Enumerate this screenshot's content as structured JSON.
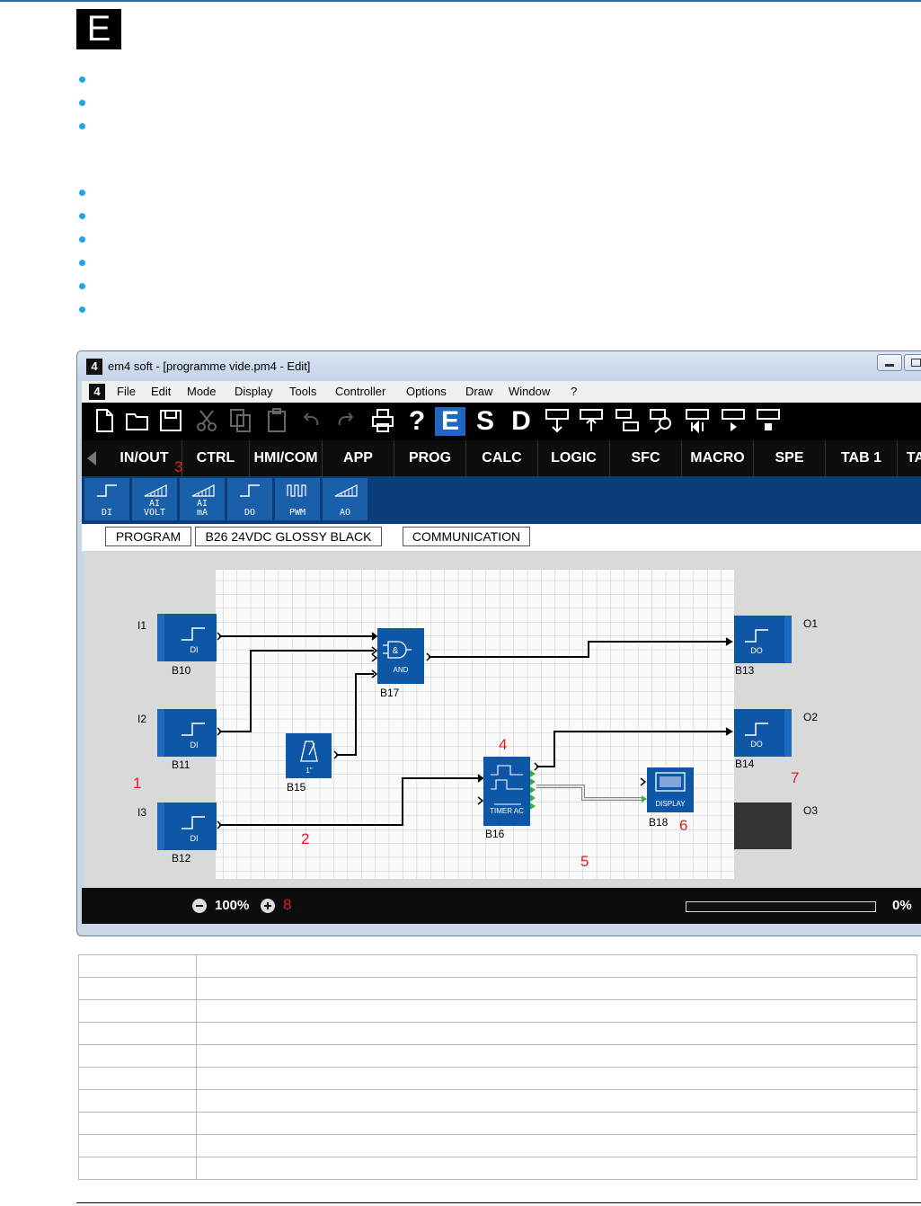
{
  "badge": "E",
  "window": {
    "title": "em4 soft - [programme vide.pm4 - Edit]",
    "app_icon": "4"
  },
  "menu": [
    "File",
    "Edit",
    "Mode",
    "Display",
    "Tools",
    "Controller",
    "Options",
    "Draw",
    "Window",
    "?"
  ],
  "toolbar": {
    "icons": [
      "new-file-icon",
      "open-folder-icon",
      "save-icon",
      "cut-icon",
      "copy-icon",
      "paste-icon",
      "undo-icon",
      "redo-icon",
      "print-icon"
    ],
    "modes": [
      "?",
      "E",
      "S",
      "D"
    ],
    "active_mode": "E"
  },
  "tabs": [
    "IN/OUT",
    "CTRL",
    "HMI/COM",
    "APP",
    "PROG",
    "CALC",
    "LOGIC",
    "SFC",
    "MACRO",
    "SPE",
    "TAB 1",
    "TA"
  ],
  "palette": [
    {
      "icon": "step-icon",
      "label": [
        "DI"
      ]
    },
    {
      "icon": "ramp-icon",
      "label": [
        "AI",
        "VOLT"
      ]
    },
    {
      "icon": "ramp-icon",
      "label": [
        "AI",
        "mA"
      ]
    },
    {
      "icon": "step-icon",
      "label": [
        "DO"
      ]
    },
    {
      "icon": "pwm-icon",
      "label": [
        "PWM"
      ]
    },
    {
      "icon": "ramp-icon",
      "label": [
        "AO"
      ]
    }
  ],
  "sheets": [
    "PROGRAM",
    "B26 24VDC GLOSSY BLACK",
    "COMMUNICATION"
  ],
  "diagram": {
    "inputs": [
      {
        "pin": "I1",
        "block": "B10",
        "type": "DI"
      },
      {
        "pin": "I2",
        "block": "B11",
        "type": "DI"
      },
      {
        "pin": "I3",
        "block": "B12",
        "type": "DI"
      }
    ],
    "outputs": [
      {
        "pin": "O1",
        "block": "B13",
        "type": "DO"
      },
      {
        "pin": "O2",
        "block": "B14",
        "type": "DO"
      },
      {
        "pin": "O3",
        "block": ""
      }
    ],
    "and_block": {
      "id": "B17",
      "label": "AND",
      "symbol": "&"
    },
    "clock_block": {
      "id": "B15",
      "label": "1\""
    },
    "timer_block": {
      "id": "B16",
      "label": "TIMER AC"
    },
    "display_block": {
      "id": "B18",
      "label": "DISPLAY"
    },
    "callouts": [
      "1",
      "2",
      "3",
      "4",
      "5",
      "6",
      "7",
      "8"
    ],
    "callout_color": "#e02020",
    "block_color": "#0e56a6"
  },
  "status": {
    "zoom": "100%",
    "progress": "0%",
    "progress_value": 0
  },
  "table_rows": 10
}
